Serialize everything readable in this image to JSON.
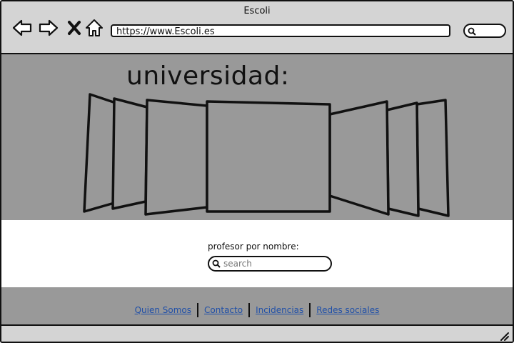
{
  "window": {
    "title": "Escoli"
  },
  "toolbar": {
    "back_icon": "back-arrow-icon",
    "forward_icon": "forward-arrow-icon",
    "stop_icon": "close-icon",
    "home_icon": "home-icon",
    "url": "https://www.Escoli.es",
    "search_icon": "search-icon"
  },
  "hero": {
    "title": "universidad:"
  },
  "search": {
    "label": "profesor por nombre:",
    "placeholder": "search"
  },
  "footer": {
    "links": [
      "Quien Somos",
      "Contacto",
      "Incidencias",
      "Redes sociales"
    ]
  },
  "colors": {
    "hero_bg": "#999999",
    "chrome_bg": "#d4d4d4",
    "link": "#1f4fa8"
  }
}
